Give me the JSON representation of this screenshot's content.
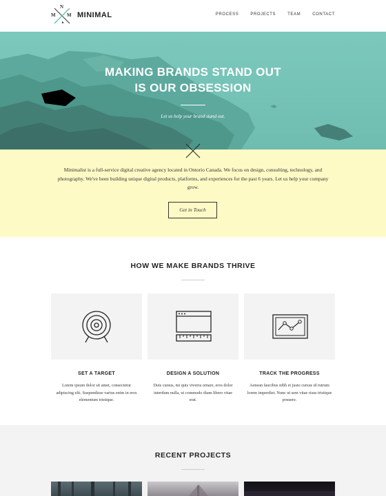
{
  "header": {
    "logo_letters": {
      "top": "N",
      "left": "M",
      "right": "M"
    },
    "brand_name": "MINIMAL",
    "nav": [
      "PROCESS",
      "PROJECTS",
      "TEAM",
      "CONTACT"
    ]
  },
  "hero": {
    "title_line1": "MAKING BRANDS STAND OUT",
    "title_line2": "IS OUR OBSESSION",
    "subtitle": "Let us help your brand stand out."
  },
  "intro": {
    "text": "Minimalist is a full-service digital creative agency located in Ontorio Canada. We focus on design, consulting, technology, and photography. We've been building unique digital products, platforms, and experiences for the past 6 years. Let us help your company grow.",
    "cta_label": "Get in Touch"
  },
  "how": {
    "title": "HOW WE MAKE BRANDS THRIVE",
    "features": [
      {
        "icon": "target-icon",
        "title": "SET A TARGET",
        "text": "Lorem ipsum dolor sit amet, consectetur adipiscing elit. Suspendisse varius enim in eros elementum tristique."
      },
      {
        "icon": "browser-ruler-icon",
        "title": "DESIGN A SOLUTION",
        "text": "Duis cursus, mi quis viverra ornare, eros dolor interdum nulla, ut commodo diam libero vitae erat."
      },
      {
        "icon": "line-chart-icon",
        "title": "TRACK THE PROGRESS",
        "text": "Aenean faucibus nibh et justo cursus id rutrum lorem imperdiet. Nunc ut sem vitae risus tristique posuere."
      }
    ]
  },
  "recent": {
    "title": "RECENT PROJECTS"
  },
  "colors": {
    "hero_teal": "#76c3b7",
    "intro_yellow": "#fefac5",
    "tile_grey": "#f3f3f3"
  }
}
